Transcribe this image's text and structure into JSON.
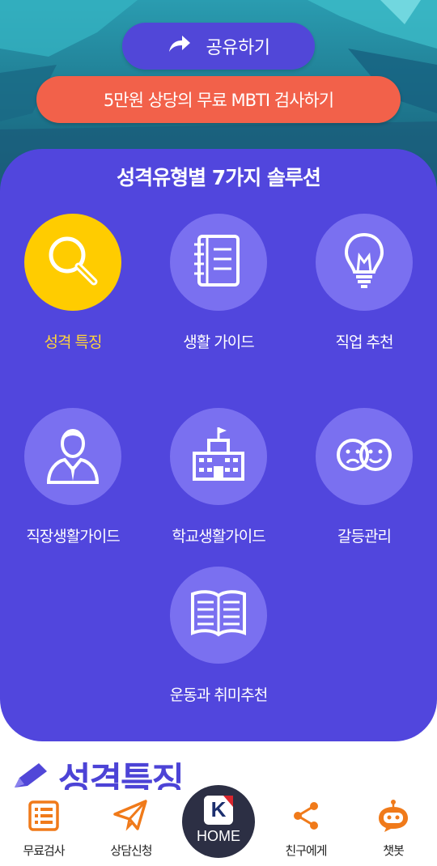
{
  "header": {
    "share_label": "공유하기",
    "mbti_button_label": "5만원 상당의 무료 MBTI 검사하기"
  },
  "solutions": {
    "title": "성격유형별 7가지 솔루션",
    "items": [
      {
        "label": "성격 특징",
        "icon": "search-icon",
        "active": true
      },
      {
        "label": "생활 가이드",
        "icon": "notebook-icon",
        "active": false
      },
      {
        "label": "직업 추천",
        "icon": "lightbulb-icon",
        "active": false
      },
      {
        "label": "직장생활가이드",
        "icon": "businessman-icon",
        "active": false
      },
      {
        "label": "학교생활가이드",
        "icon": "school-icon",
        "active": false
      },
      {
        "label": "갈등관리",
        "icon": "faces-icon",
        "active": false
      },
      {
        "label": "운동과 취미추천",
        "icon": "book-icon",
        "active": false
      }
    ]
  },
  "section": {
    "title": "성격특징",
    "icon": "pencil-icon"
  },
  "bottom_nav": {
    "items": [
      {
        "label": "무료검사",
        "icon": "list-icon"
      },
      {
        "label": "상담신청",
        "icon": "paper-plane-icon"
      },
      {
        "label": "친구에게",
        "icon": "share-icon"
      },
      {
        "label": "챗봇",
        "icon": "chatbot-icon"
      }
    ],
    "home_label": "HOME",
    "home_letter": "K"
  },
  "colors": {
    "panel": "#5146dd",
    "circle": "#7a70f0",
    "active_circle": "#ffcc00",
    "active_label": "#ffd43a",
    "mbti_button": "#f2614a",
    "nav_icon": "#f07a1a"
  }
}
